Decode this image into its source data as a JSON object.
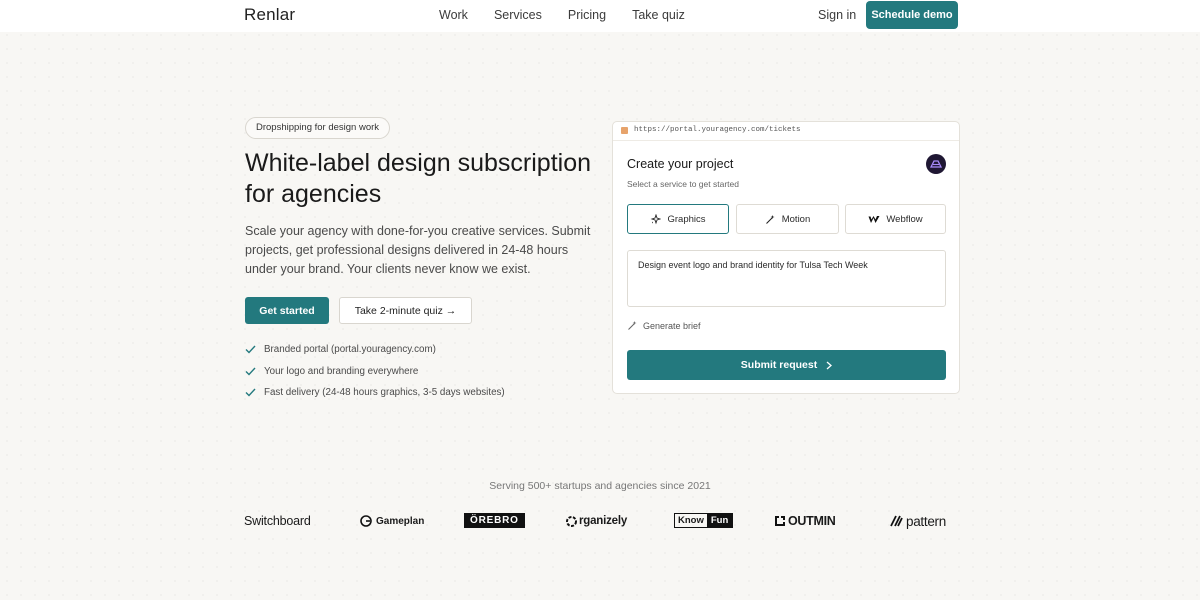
{
  "nav": {
    "logo": "Renlar",
    "links": [
      "Work",
      "Services",
      "Pricing",
      "Take quiz"
    ],
    "signin": "Sign in",
    "cta": "Schedule demo"
  },
  "hero": {
    "pill": "Dropshipping for design work",
    "title": "White-label design subscription for agencies",
    "subtitle": "Scale your agency with done-for-you creative services. Submit projects, get professional designs delivered in 24-48 hours under your brand. Your clients never know we exist.",
    "primary_cta": "Get started",
    "secondary_cta": "Take 2-minute quiz →",
    "features": [
      "Branded portal (portal.youragency.com)",
      "Your logo and branding everywhere",
      "Fast delivery (24-48 hours graphics, 3-5 days websites)"
    ]
  },
  "portal": {
    "url": "https://portal.youragency.com/tickets",
    "title": "Create your project",
    "subtitle": "Select a service to get started",
    "services": [
      "Graphics",
      "Motion",
      "Webflow"
    ],
    "active_service": "Graphics",
    "brief_value": "Design event logo and brand identity for Tulsa Tech Week",
    "generate_label": "Generate brief",
    "submit_label": "Submit request"
  },
  "trust": {
    "text": "Serving 500+ startups and agencies since 2021",
    "logos": [
      "Switchboard",
      "Gameplan",
      "ÖREBRO",
      "rganizely",
      "Know",
      "Fun",
      "OUTMIN",
      "pattern"
    ]
  },
  "colors": {
    "accent": "#23797e",
    "background": "#f8f7f4"
  }
}
